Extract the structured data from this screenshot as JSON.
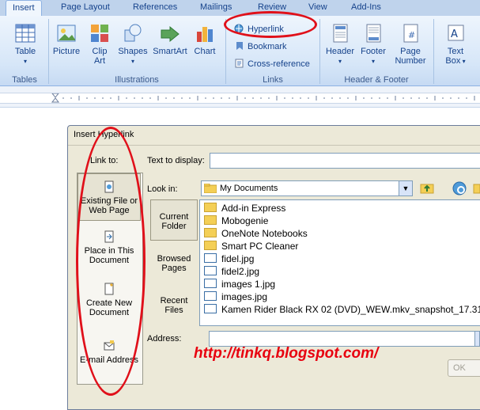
{
  "tabs": [
    {
      "label": "Insert",
      "active": true
    },
    {
      "label": "Page Layout"
    },
    {
      "label": "References"
    },
    {
      "label": "Mailings"
    },
    {
      "label": "Review"
    },
    {
      "label": "View"
    },
    {
      "label": "Add-Ins"
    }
  ],
  "ribbon": {
    "tables": {
      "button": "Table",
      "group": "Tables"
    },
    "illustrations": {
      "picture": "Picture",
      "clipart_l1": "Clip",
      "clipart_l2": "Art",
      "shapes": "Shapes",
      "smartart": "SmartArt",
      "chart": "Chart",
      "group": "Illustrations"
    },
    "links": {
      "hyperlink": "Hyperlink",
      "bookmark": "Bookmark",
      "crossref": "Cross-reference",
      "group": "Links"
    },
    "header_footer": {
      "header": "Header",
      "footer": "Footer",
      "pagenum_l1": "Page",
      "pagenum_l2": "Number",
      "group": "Header & Footer"
    },
    "text": {
      "textbox_l1": "Text",
      "textbox_l2": "Box"
    }
  },
  "dialog": {
    "title": "Insert Hyperlink",
    "link_to_label": "Link to:",
    "text_to_display_label": "Text to display:",
    "text_to_display_value": "",
    "look_in_label": "Look in:",
    "look_in_value": "My Documents",
    "address_label": "Address:",
    "address_value": "",
    "ok_label": "OK",
    "link_items": [
      {
        "l1": "Existing File or",
        "l2": "Web Page",
        "selected": true
      },
      {
        "l1": "Place in This",
        "l2": "Document"
      },
      {
        "l1": "Create New",
        "l2": "Document"
      },
      {
        "l1": "E-mail Address",
        "l2": ""
      }
    ],
    "side_items": [
      {
        "l1": "Current",
        "l2": "Folder",
        "selected": true
      },
      {
        "l1": "Browsed",
        "l2": "Pages"
      },
      {
        "l1": "Recent",
        "l2": "Files"
      }
    ],
    "files": [
      {
        "name": "Add-in Express",
        "type": "folder"
      },
      {
        "name": "Mobogenie",
        "type": "folder"
      },
      {
        "name": "OneNote Notebooks",
        "type": "folder"
      },
      {
        "name": "Smart PC Cleaner",
        "type": "folder"
      },
      {
        "name": "fidel.jpg",
        "type": "image"
      },
      {
        "name": "fidel2.jpg",
        "type": "image"
      },
      {
        "name": "images 1.jpg",
        "type": "image"
      },
      {
        "name": "images.jpg",
        "type": "image"
      },
      {
        "name": "Kamen Rider Black RX 02 (DVD)_WEW.mkv_snapshot_17.31",
        "type": "image"
      }
    ]
  },
  "overlay": {
    "url": "http://tinkq.blogspot.com/",
    "annotation_color": "#e0101a"
  },
  "colors": {
    "ribbon_text": "#15428b",
    "tab_bar": "#bfd3ec",
    "dialog_bg": "#ece9d8"
  }
}
